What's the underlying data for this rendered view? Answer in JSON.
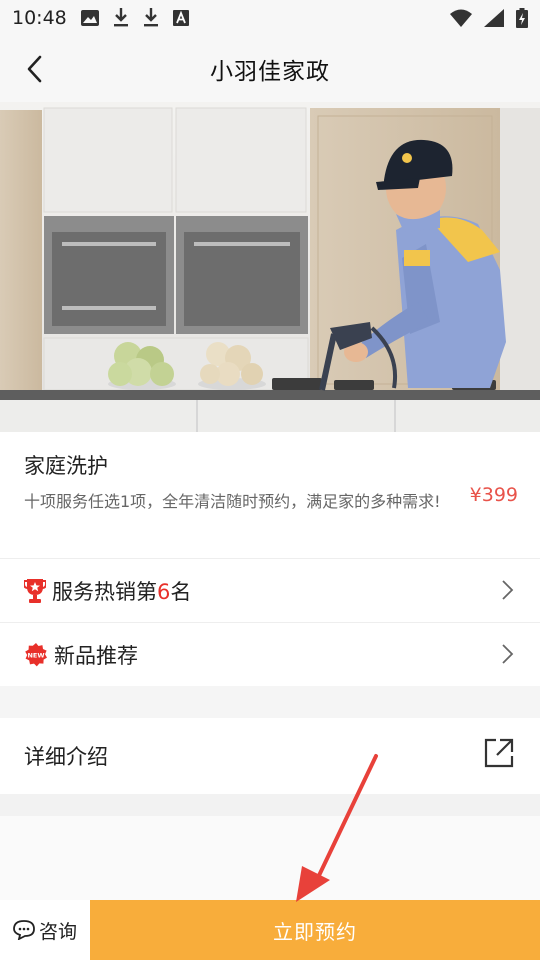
{
  "status_bar": {
    "time": "10:48",
    "left_icons": [
      "image-icon",
      "download-icon",
      "download-icon",
      "font-a-icon"
    ],
    "right_icons": [
      "wifi-icon",
      "signal-icon",
      "battery-charging-icon"
    ]
  },
  "nav": {
    "title": "小羽佳家政",
    "back_icon": "chevron-left-icon"
  },
  "hero": {
    "image": "worker-steam-cleaning-kitchen-photo"
  },
  "service": {
    "title": "家庭洗护",
    "description": "十项服务任选1项，全年清洁随时预约，满足家的多种需求!",
    "price": "¥399",
    "price_color": "#e8534a"
  },
  "rank_row": {
    "icon": "trophy-icon",
    "label_prefix": "服务热销第",
    "rank": "6",
    "label_suffix": "名",
    "rank_color": "#e8302a"
  },
  "new_row": {
    "icon": "new-badge-icon",
    "badge_text": "NEW",
    "label": "新品推荐"
  },
  "detail_row": {
    "label": "详细介绍",
    "icon": "external-link-icon"
  },
  "bottom": {
    "consult_label": "咨询",
    "consult_icon": "chat-bubble-icon",
    "book_label": "立即预约",
    "book_color": "#f8ad3b"
  },
  "annotation": {
    "arrow_color": "#e8413a"
  }
}
